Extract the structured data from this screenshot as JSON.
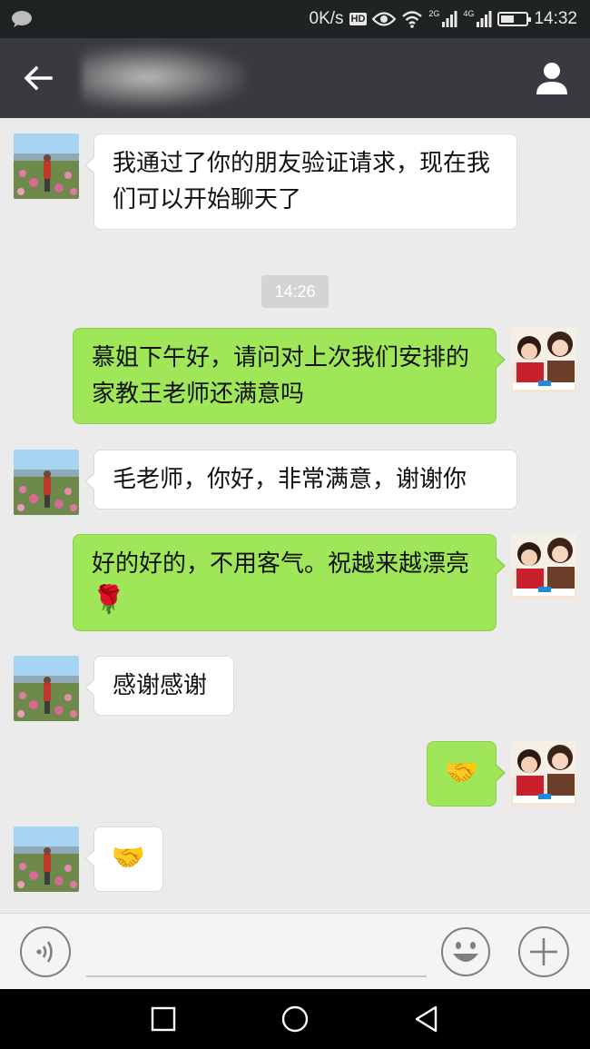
{
  "status_bar": {
    "speed": "0K/s",
    "hd_badge": "HD",
    "net1": "2G",
    "net2": "4G",
    "time": "14:32",
    "battery_percent": 60,
    "icons": [
      "message-notification-icon",
      "eye-icon",
      "wifi-icon",
      "signal-icon",
      "signal-icon",
      "battery-icon"
    ]
  },
  "header": {
    "back_icon": "back-arrow-icon",
    "profile_icon": "person-icon"
  },
  "timestamp": "14:26",
  "messages": [
    {
      "side": "in",
      "text": "我通过了你的朋友验证请求，现在我们可以开始聊天了"
    },
    {
      "side": "out",
      "text": "慕姐下午好，请问对上次我们安排的家教王老师还满意吗"
    },
    {
      "side": "in",
      "text": "毛老师，你好，非常满意，谢谢你"
    },
    {
      "side": "out",
      "text": "好的好的，不用客气。祝越来越漂亮",
      "emoji": "🌹"
    },
    {
      "side": "in",
      "text": "感谢感谢"
    },
    {
      "side": "out",
      "text": "",
      "emoji": "🤝"
    },
    {
      "side": "in",
      "text": "",
      "emoji": "🤝"
    }
  ],
  "input_bar": {
    "voice_icon": "voice-icon",
    "emoji_icon": "smiley-icon",
    "plus_icon": "plus-icon"
  },
  "nav_bar": {
    "icons": [
      "square-recent-icon",
      "circle-home-icon",
      "triangle-back-icon"
    ]
  },
  "colors": {
    "status_bar_bg": "#1f2324",
    "title_bar_bg": "#393a3f",
    "chat_bg": "#ebebeb",
    "incoming_bubble": "#ffffff",
    "outgoing_bubble": "#9fe658",
    "timestamp_bg": "#d4d4d4"
  }
}
